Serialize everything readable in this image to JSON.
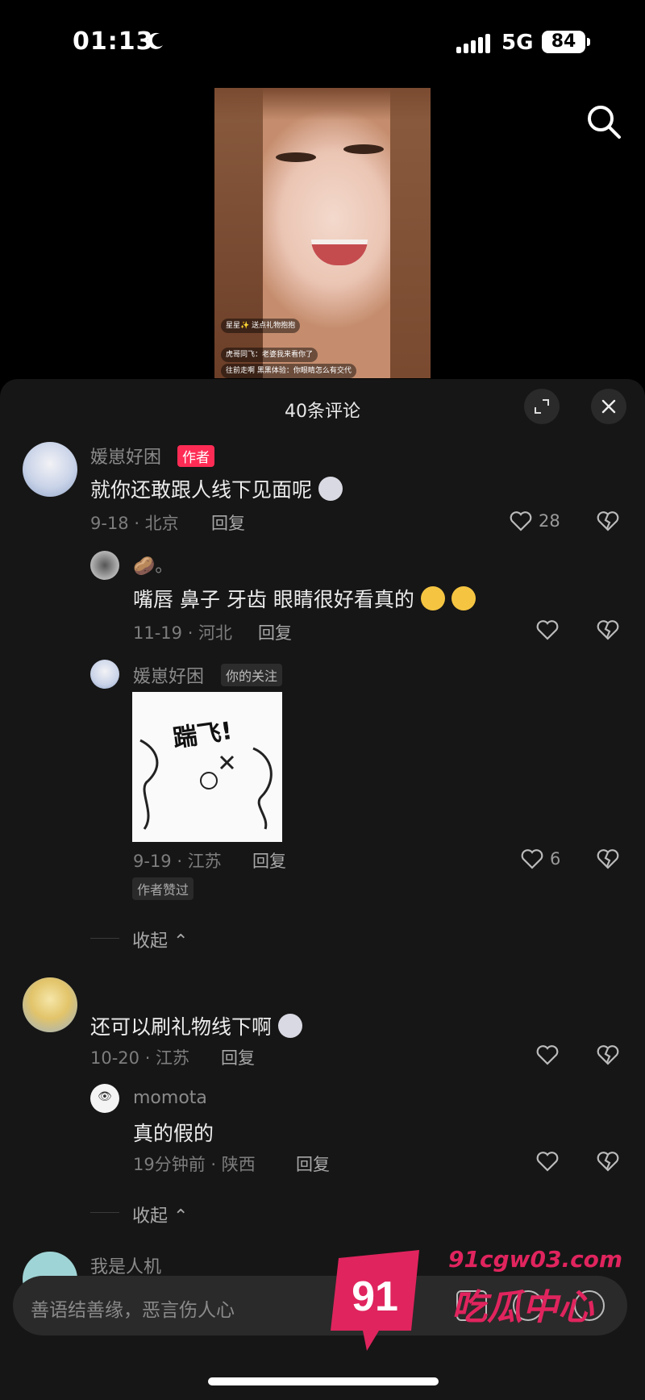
{
  "status_bar": {
    "time": "01:13",
    "network": "5G",
    "battery": "84"
  },
  "video_overlay": {
    "user_name": "星星✨",
    "user_sub": "送点礼物抱抱",
    "chat_rows": [
      "虎哥同飞：老婆我来看你了",
      "往前走啊 黑黑体验：你眼睛怎么有交代"
    ]
  },
  "panel": {
    "title": "40条评论"
  },
  "comments": [
    {
      "user": "媛崽好困",
      "badge": "作者",
      "text": "就你还敢跟人线下见面呢",
      "date_loc": "9-18 · 北京",
      "reply": "回复",
      "likes": "28",
      "replies": [
        {
          "user": "🥔。",
          "text": "嘴唇 鼻子 牙齿 眼睛很好看真的",
          "date_loc": "11-19 · 河北",
          "reply": "回复",
          "likes": ""
        },
        {
          "user": "媛崽好困",
          "badge": "你的关注",
          "sticker_text": "踹飞!",
          "date_loc": "9-19 · 江苏",
          "reply": "回复",
          "likes": "6",
          "tag": "作者赞过"
        }
      ],
      "collapse": "收起"
    },
    {
      "user": "",
      "text": "还可以刷礼物线下啊",
      "date_loc": "10-20 · 江苏",
      "reply": "回复",
      "likes": "",
      "replies": [
        {
          "user": "momota",
          "text": "真的假的",
          "date_loc": "19分钟前 · 陕西",
          "reply": "回复",
          "likes": ""
        }
      ],
      "collapse": "收起"
    },
    {
      "user": "我是人机"
    }
  ],
  "input": {
    "placeholder": "善语结善缘，恶言伤人心"
  },
  "watermark": {
    "site": "91cgw03.com",
    "brand": "吃瓜中心",
    "number": "91"
  },
  "colors": {
    "author_badge": "#fe2c55",
    "panel_bg": "#161616",
    "watermark": "#e0245e"
  }
}
